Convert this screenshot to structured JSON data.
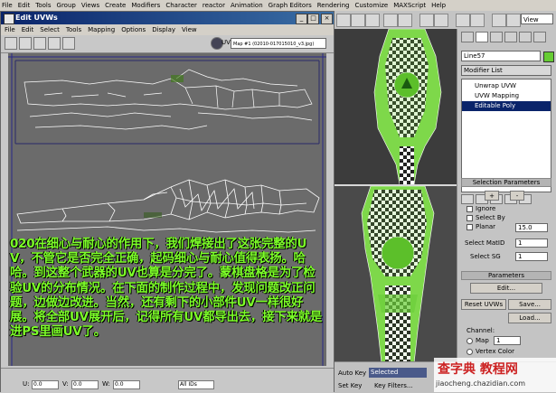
{
  "menubar": {
    "items": [
      "File",
      "Edit",
      "Tools",
      "Group",
      "Views",
      "Create",
      "Modifiers",
      "Character",
      "reactor",
      "Animation",
      "Graph Editors",
      "Rendering",
      "Customize",
      "MAXScript",
      "Help"
    ]
  },
  "main_toolbar": {
    "view_dropdown": "View"
  },
  "uvw_window": {
    "title": "Edit UVWs",
    "menu": [
      "File",
      "Edit",
      "Select",
      "Tools",
      "Mapping",
      "Options",
      "Display",
      "View"
    ],
    "uv_label": "UV",
    "map_dropdown": "Map #1 (02010-017015010_v3.jpg)",
    "caption": "020在细心与耐心的作用下，我们焊接出了这张完整的UV，不管它是否完全正确，起码细心与耐心值得表扬。哈哈。到这整个武器的UV也算是分完了。蒙棋盘格是为了检验UV的分布情况。在下面的制作过程中，发现问题改正问题，边做边改进。当然，还有剩下的小部件UV一样很好展。将全部UV展开后，记得所有UV都导出去，接下来就是进PS里画UV了。",
    "status": {
      "u_label": "U:",
      "u_value": "0.0",
      "v_label": "V:",
      "v_value": "0.0",
      "w_label": "W:",
      "w_value": "0.0",
      "all_ids": "All IDs"
    }
  },
  "command_panel": {
    "object_name": "Line57",
    "object_color": "#66cc33",
    "modifier_list": "Modifier List",
    "stack": [
      "Unwrap UVW",
      "UVW Mapping",
      "Editable Poly"
    ],
    "selection_params": {
      "title": "Selection Parameters",
      "plus": "+",
      "minus": "-",
      "ignore": "Ignore",
      "select_by": "Select By",
      "planar": "Planar",
      "planar_value": "15.0",
      "select_matid": "Select MatID",
      "select_sg": "Select SG",
      "matid_value": "1",
      "sg_value": "1"
    },
    "parameters": {
      "title": "Parameters",
      "edit_button": "Edit...",
      "reset_uvws": "Reset UVWs",
      "save_button": "Save...",
      "load_button": "Load...",
      "channel_label": "Channel:",
      "map_radio": "Map",
      "map_value": "1",
      "vertex_color": "Vertex Color"
    }
  },
  "bottom": {
    "auto_key": "Auto Key",
    "selected": "Selected",
    "set_key": "Set Key",
    "key_filters": "Key Filters..."
  },
  "watermark": {
    "line1": "查字典 教程网",
    "line2": "jiaocheng.chazidian.com"
  }
}
